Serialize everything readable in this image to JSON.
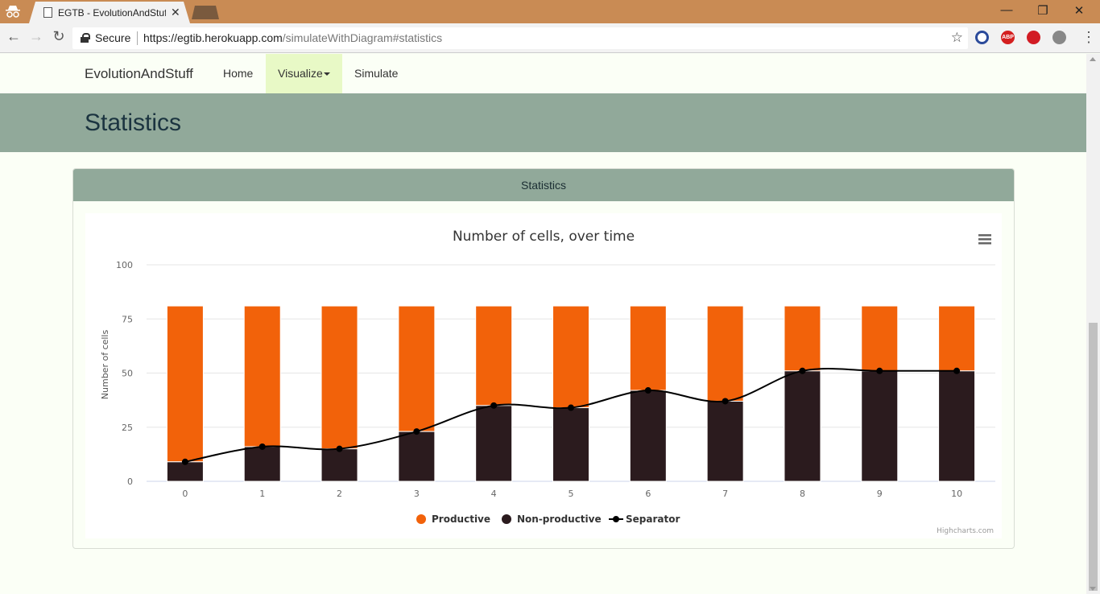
{
  "browser": {
    "tab_title": "EGTB - EvolutionAndStuf",
    "secure_label": "Secure",
    "url_host": "https://egtib.herokuapp.com",
    "url_path": "/simulateWithDiagram#statistics",
    "extensions": [
      "ABP"
    ]
  },
  "navbar": {
    "brand": "EvolutionAndStuff",
    "items": [
      {
        "label": "Home"
      },
      {
        "label": "Visualize"
      },
      {
        "label": "Simulate"
      }
    ]
  },
  "page": {
    "heading": "Statistics"
  },
  "panel": {
    "title": "Statistics"
  },
  "chart_data": {
    "type": "bar",
    "title": "Number of cells, over time",
    "ylabel": "Number of cells",
    "xlabel": "",
    "ylim": [
      0,
      100
    ],
    "yticks": [
      0,
      25,
      50,
      75,
      100
    ],
    "categories": [
      "0",
      "1",
      "2",
      "3",
      "4",
      "5",
      "6",
      "7",
      "8",
      "9",
      "10"
    ],
    "stacked": true,
    "series": [
      {
        "name": "Productive",
        "type": "bar",
        "color": "#f2620a",
        "values": [
          72,
          65,
          66,
          58,
          46,
          47,
          39,
          44,
          30,
          30,
          30
        ]
      },
      {
        "name": "Non-productive",
        "type": "bar",
        "color": "#2b1b1e",
        "values": [
          9,
          16,
          15,
          23,
          35,
          34,
          42,
          37,
          51,
          51,
          51
        ]
      },
      {
        "name": "Separator",
        "type": "line",
        "color": "#000000",
        "values": [
          9,
          16,
          15,
          23,
          35,
          34,
          42,
          37,
          51,
          51,
          51
        ]
      }
    ],
    "legend_position": "bottom",
    "credits": "Highcharts.com"
  }
}
